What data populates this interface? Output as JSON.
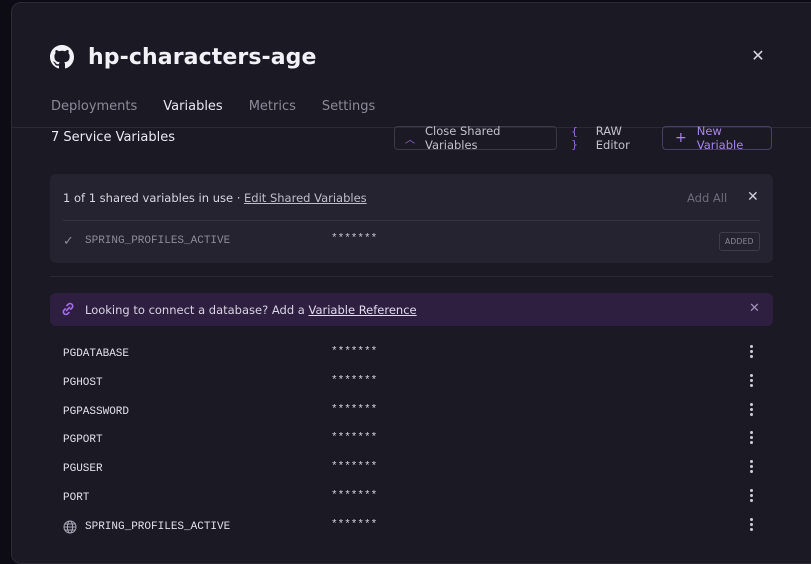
{
  "header": {
    "title": "hp-characters-age",
    "close_icon": "close-icon"
  },
  "tabs": [
    {
      "label": "Deployments",
      "active": false
    },
    {
      "label": "Variables",
      "active": true
    },
    {
      "label": "Metrics",
      "active": false
    },
    {
      "label": "Settings",
      "active": false
    }
  ],
  "toolbar": {
    "service_count": "7 Service Variables",
    "close_shared_label": "Close Shared Variables",
    "raw_editor_label": "RAW Editor",
    "new_variable_label": "New Variable"
  },
  "shared": {
    "usage_text": "1 of 1 shared variables in use · ",
    "edit_link": "Edit Shared Variables",
    "add_all": "Add All",
    "rows": [
      {
        "key": "SPRING_PROFILES_ACTIVE",
        "value": "*******",
        "badge": "ADDED"
      }
    ]
  },
  "banner": {
    "text": "Looking to connect a database? Add a ",
    "link": "Variable Reference"
  },
  "variables": [
    {
      "key": "PGDATABASE",
      "value": "*******"
    },
    {
      "key": "PGHOST",
      "value": "*******"
    },
    {
      "key": "PGPASSWORD",
      "value": "*******"
    },
    {
      "key": "PGPORT",
      "value": "*******"
    },
    {
      "key": "PGUSER",
      "value": "*******"
    },
    {
      "key": "PORT",
      "value": "*******"
    },
    {
      "key": "SPRING_PROFILES_ACTIVE",
      "value": "*******",
      "shared": true
    }
  ],
  "colors": {
    "accent": "#9f6ae0",
    "panel": "#1b1a24",
    "banner": "#2e1f40"
  }
}
